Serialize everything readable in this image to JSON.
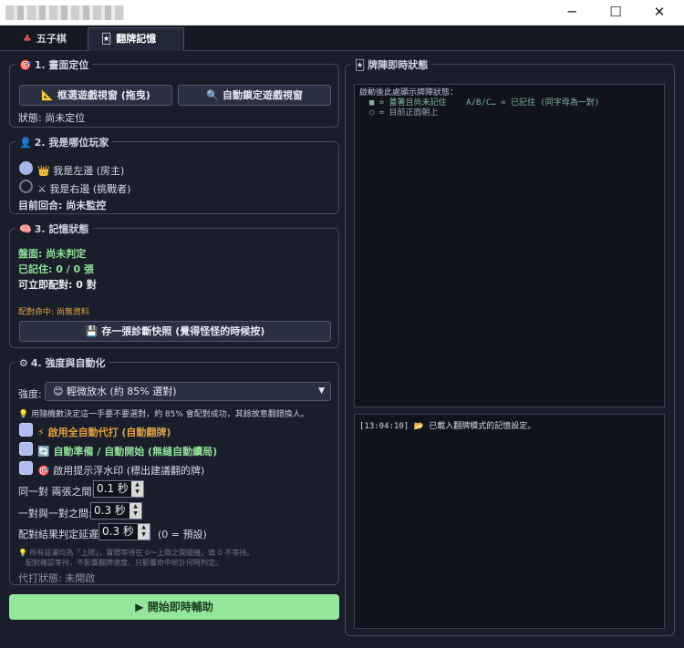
{
  "window": {
    "minimize_label": "─",
    "maximize_label": "☐",
    "close_label": "✕"
  },
  "tabs": [
    {
      "icon": "♣",
      "label": "五子棋"
    },
    {
      "icon": "🃏",
      "label": "翻牌記憶"
    }
  ],
  "section1": {
    "icon": "🎯",
    "title": "1. 畫面定位",
    "frame_button": {
      "icon": "📐",
      "label": "框選遊戲視窗 (拖曳)"
    },
    "auto_button": {
      "icon": "🔍",
      "label": "自動鎖定遊戲視窗"
    },
    "status": "狀態: 尚未定位"
  },
  "section2": {
    "icon": "👤",
    "title": "2. 我是哪位玩家",
    "option_left": {
      "icon": "👑",
      "label": "我是左邊 (房主)",
      "selected": true
    },
    "option_right": {
      "icon": "⚔",
      "label": "我是右邊 (挑戰者)",
      "selected": false
    },
    "current_turn": "目前回合: 尚未監控"
  },
  "section3": {
    "icon": "🧠",
    "title": "3. 記憶狀態",
    "board": "盤面: 尚未判定",
    "remembered": "已記住: 0 / 0 張",
    "pairable": "可立即配對: 0 對",
    "matching": "配對命中: 尚無資料",
    "snapshot_button": {
      "icon": "💾",
      "label": "存一張診斷快照 (覺得怪怪的時候按)"
    }
  },
  "section4": {
    "icon": "⚙",
    "title": "4. 強度與自動化",
    "strength_label": "強度:",
    "strength_value": "😊 輕微放水 (約 85% 選對)",
    "hint": "💡 用隨機數決定這一手要不要選對，約 85% 會配對成功，其餘故意翻錯換人。",
    "toggle_autoplay": {
      "icon": "⚡",
      "label": "啟用全自動代打 (自動翻牌)"
    },
    "toggle_ready": {
      "icon": "🔄",
      "label": "自動準備 / 自動開始 (無縫自動續局)"
    },
    "toggle_watermark": {
      "icon": "🎯",
      "label": "啟用提示浮水印 (標出建議翻的牌)"
    },
    "delay_same_pair": {
      "label": "同一對 兩張之間:",
      "value": "0.1 秒"
    },
    "delay_between_pairs": {
      "label": "一對與一對之間:",
      "value": "0.3 秒"
    },
    "delay_result": {
      "label": "配對結果判定延遲:",
      "value": "0.3 秒",
      "note": "(0 = 預設)"
    },
    "note_line1": "💡 所有延遲均為「上限」，實際等待在 0～上限之間隨機，填 0 不等待。",
    "note_line2": "配對確認等待，不影響翻牌速度，只影響命中統計何時判定。",
    "autoplay_status": "代打狀態: 未開啟"
  },
  "start_button": {
    "label": "▶ 開始即時輔助"
  },
  "board_panel": {
    "icon": "🃏",
    "title": "牌陣即時狀態",
    "lines": [
      "啟動後此處顯示牌陣狀態：",
      "  ■ = 蓋著且尚未記住    A/B/C… = 已記住 (同字母為一對)",
      "  ○ = 目前正面朝上"
    ]
  },
  "log": {
    "entries": [
      {
        "time": "[13:04:10]",
        "icon": "📂",
        "text": "已載入翻牌模式的記憶設定。"
      }
    ]
  }
}
